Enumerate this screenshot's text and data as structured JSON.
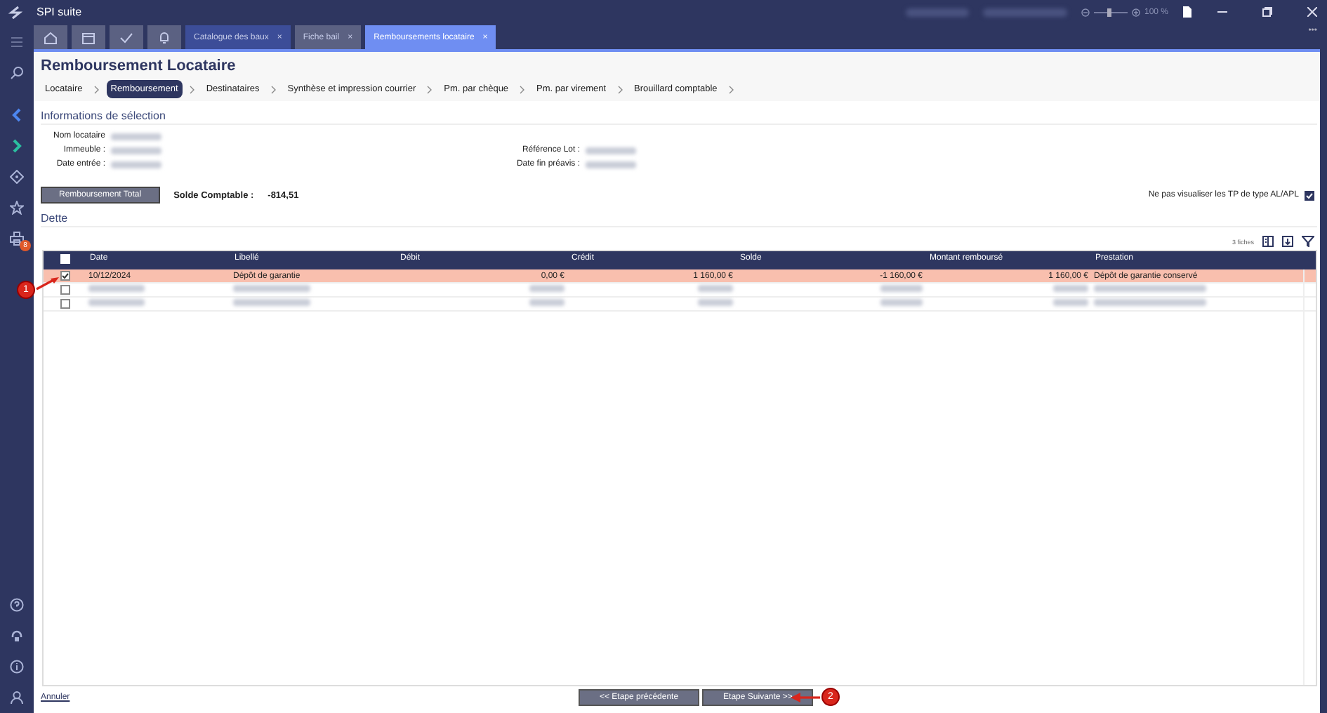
{
  "window": {
    "title": "SPI suite",
    "zoom": "100 %",
    "more": "•••"
  },
  "sidebar": {
    "badge": "8"
  },
  "zoom_slider": {
    "level": 0.45
  },
  "tabs": [
    {
      "kind": "icon",
      "selected": false
    },
    {
      "kind": "icon",
      "selected": false
    },
    {
      "kind": "icon",
      "selected": false
    },
    {
      "kind": "icon",
      "selected": false
    },
    {
      "kind": "text",
      "label": "Catalogue des baux",
      "close": "×",
      "selected": false,
      "pinned": true
    },
    {
      "kind": "text",
      "label": "Fiche bail",
      "close": "×",
      "selected": false,
      "pinned": false
    },
    {
      "kind": "text",
      "label": "Remboursements locataire",
      "close": "×",
      "selected": true,
      "pinned": false
    }
  ],
  "page": {
    "title": "Remboursement Locataire",
    "steps": [
      {
        "label": "Locataire",
        "selected": false
      },
      {
        "label": "Remboursement",
        "selected": true
      },
      {
        "label": "Destinataires",
        "selected": false
      },
      {
        "label": "Synthèse et impression courrier",
        "selected": false
      },
      {
        "label": "Pm. par chèque",
        "selected": false
      },
      {
        "label": "Pm. par virement",
        "selected": false
      },
      {
        "label": "Brouillard comptable",
        "selected": false
      }
    ],
    "selection": {
      "title": "Informations de sélection",
      "left": [
        {
          "label": "Nom locataire",
          "redacted": true
        },
        {
          "label": "Immeuble :",
          "redacted": true
        },
        {
          "label": "Date entrée :",
          "redacted": true
        }
      ],
      "right": [
        {
          "label": "Référence Lot :",
          "redacted": true
        },
        {
          "label": "Date fin préavis :",
          "redacted": true
        }
      ]
    },
    "total_button": "Remboursement Total",
    "balance_label": "Solde Comptable :",
    "balance": "-814,51",
    "filter": {
      "label": "Ne pas visualiser les TP de type AL/APL",
      "checked": true
    },
    "debt": {
      "title": "Dette",
      "count": "3 fiches",
      "select_all": {
        "checked": false
      },
      "columns": [
        {
          "label": "Date",
          "kind": "text"
        },
        {
          "label": "Libellé",
          "kind": "text"
        },
        {
          "label": "Débit",
          "kind": "amount"
        },
        {
          "label": "Crédit",
          "kind": "amount"
        },
        {
          "label": "Solde",
          "kind": "amount"
        },
        {
          "label": "Montant remboursé",
          "kind": "amount"
        },
        {
          "label": "Prestation",
          "kind": "text"
        }
      ],
      "rows": [
        {
          "selected": true,
          "checked": true,
          "redacted": false,
          "cells": [
            "10/12/2024",
            "Dépôt de garantie",
            "0,00 €",
            "1 160,00 €",
            "-1 160,00 €",
            "1 160,00 €",
            "Dépôt de garantie conservé"
          ]
        },
        {
          "selected": false,
          "checked": false,
          "redacted": true
        },
        {
          "selected": false,
          "checked": false,
          "redacted": true
        }
      ]
    },
    "cancel": "Annuler",
    "prev": "<< Etape précédente",
    "next": "Etape Suivante >>"
  },
  "annotations": [
    {
      "kind": "row",
      "label": "1"
    },
    {
      "kind": "next",
      "label": "2"
    }
  ]
}
